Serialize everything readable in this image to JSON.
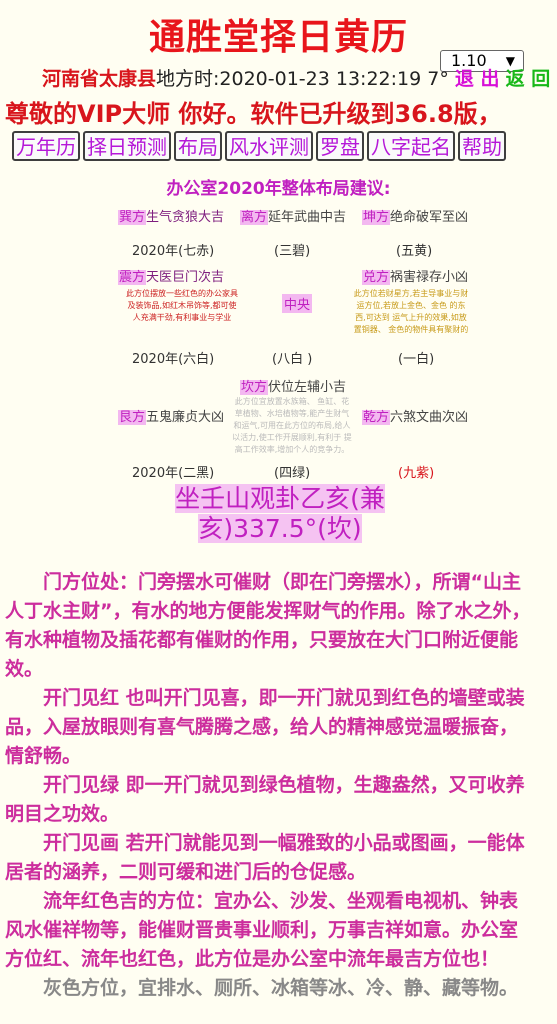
{
  "header": {
    "title": "通胜堂择日黄历",
    "version": "1.10"
  },
  "location_bar": {
    "place": "河南省太康县",
    "local_time_label": "地方时:2020-01-23 13:22:19",
    "degree": "7°",
    "exit": "退 出",
    "back": "返 回"
  },
  "welcome": "尊敬的VIP大师 你好。软件已升级到36.8版，",
  "nav": {
    "items": [
      "万年历",
      "择日预测",
      "布局",
      "风水评测",
      "罗盘",
      "八字起名",
      "帮助"
    ]
  },
  "layout": {
    "title": "办公室2020年整体布局建议:",
    "cells": {
      "xun": {
        "dir": "巽方",
        "name": "生气贪狼大吉",
        "year": "2020年(七赤)"
      },
      "li": {
        "dir": "离方",
        "name": "延年武曲中吉",
        "star": "(三碧)"
      },
      "kun": {
        "dir": "坤方",
        "name": "绝命破军至凶",
        "star": "(五黄)"
      },
      "zhen": {
        "dir": "震方",
        "name": "天医巨门次吉",
        "year": "2020年(六白)",
        "note": "此方位摆放一些红色的办公家具及装饰品,如红木吊饰等,都可使人充满干劲,有利事业与学业"
      },
      "center": {
        "label": "中央",
        "star": "(八白 )"
      },
      "dui": {
        "dir": "兑方",
        "name": "祸害禄存小凶",
        "star": "(一白)",
        "note": "此方位若财星方,若主导事业与财运方位,若放上金色、金色 的东西,可达到 运气上升的效果,如放置铜器、 金色的物件具有聚财的效果等。此方位可摆放葫芦 等物品,可降低该 方位的凶气,守住自己的财运"
      },
      "kan": {
        "dir": "坎方",
        "name": "伏位左辅小吉",
        "note": "此方位宜放置水族箱、 鱼缸、花草植物、水培植物等,能产生财气和运气,可用在此方位的布局,给人以活力,使工作开展顺利,有利于 提高工作效率,增加个人的竞争力。"
      },
      "gen": {
        "dir": "艮方",
        "name": "五鬼廉贞大凶",
        "year": "2020年(二黑)"
      },
      "kan_star": "(四绿)",
      "qian": {
        "dir": "乾方",
        "name": "六煞文曲次凶",
        "star": "(九紫)"
      }
    }
  },
  "mountain": "坐壬山观卦乙亥(兼亥)337.5°(坎)",
  "paragraphs": [
    "门方位处：门旁摆水可催财（即在门旁摆水），所谓“山主",
    "人丁水主财”，有水的地方便能发挥财气的作用。除了水之外，",
    "有水种植物及插花都有催财的作用，只要放在大门口附近便能",
    "效。",
    "开门见红 也叫开门见喜，即一开门就见到红色的墙壁或装",
    "品，入屋放眼则有喜气腾腾之感，给人的精神感觉温暖振奋，",
    "情舒畅。",
    "开门见绿 即一开门就见到绿色植物，生趣盎然，又可收养",
    "明目之功效。",
    "开门见画 若开门就能见到一幅雅致的小品或图画，一能体",
    "居者的涵养，二则可缓和进门后的仓促感。",
    "流年红色吉的方位：宜办公、沙发、坐观看电视机、钟表",
    "风水催祥物等，能催财晋贵事业顺利，万事吉祥如意。办公室",
    "方位红、流年也红色，此方位是办公室中流年最吉方位也！",
    "灰色方位，宜排水、厕所、冰箱等冰、冷、静、藏等物。"
  ]
}
